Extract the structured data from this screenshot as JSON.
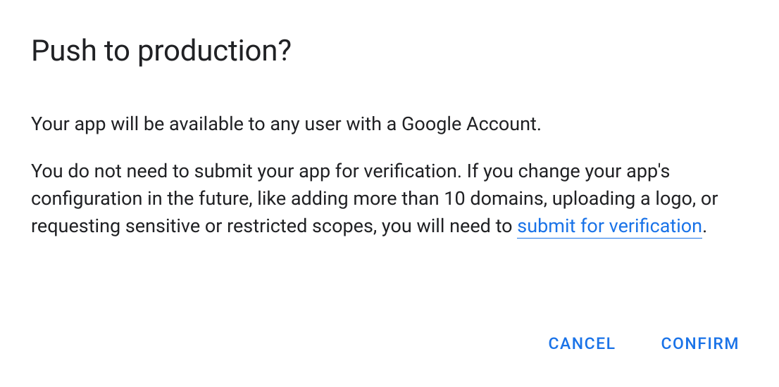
{
  "dialog": {
    "title": "Push to production?",
    "paragraph1": "Your app will be available to any user with a Google Account.",
    "paragraph2_before_link": "You do not need to submit your app for verification. If you change your app's configuration in the future, like adding more than 10 domains, uploading a logo, or requesting sensitive or restricted scopes, you will need to ",
    "link_text": "submit for verification",
    "paragraph2_after_link": ".",
    "buttons": {
      "cancel": "CANCEL",
      "confirm": "CONFIRM"
    }
  }
}
